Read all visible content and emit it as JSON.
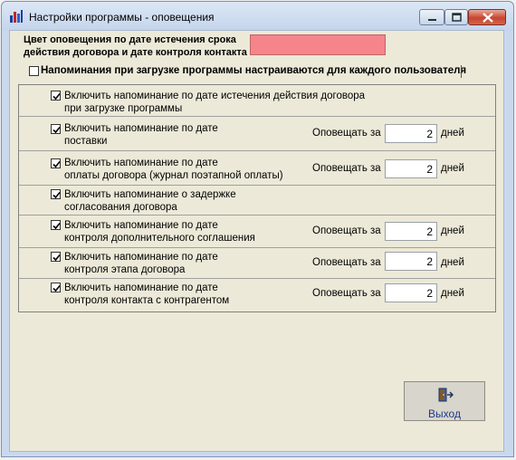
{
  "window": {
    "title": "Настройки программы - оповещения"
  },
  "color_setting": {
    "label": "Цвет оповещения по дате истечения срока действия договора и дате контроля контакта",
    "color": "#f5858a"
  },
  "per_user": {
    "label": "Напоминания при загрузке программы настраиваются для каждого пользователя",
    "checked": false
  },
  "notify_label": "Оповещать за",
  "days_label": "дней",
  "reminders": [
    {
      "line1": "Включить напоминание по дате истечения действия договора",
      "line2": "при загрузке программы",
      "checked": true
    },
    {
      "line1": "Включить напоминание по дате",
      "line2": "поставки",
      "checked": true,
      "days": "2"
    },
    {
      "line1": "Включить напоминание по дате",
      "line2": "оплаты договора (журнал поэтапной оплаты)",
      "checked": true,
      "days": "2"
    },
    {
      "line1": "Включить напоминание о задержке",
      "line2": "согласования договора",
      "checked": true
    },
    {
      "line1": "Включить напоминание по дате",
      "line2": "контроля дополнительного соглашения",
      "checked": true,
      "days": "2"
    },
    {
      "line1": "Включить напоминание по дате",
      "line2": "контроля этапа договора",
      "checked": true,
      "days": "2"
    },
    {
      "line1": "Включить напоминание по дате",
      "line2": "контроля контакта с контрагентом",
      "checked": true,
      "days": "2"
    }
  ],
  "exit_button": {
    "label": "Выход",
    "icon": "exit-door-icon"
  }
}
